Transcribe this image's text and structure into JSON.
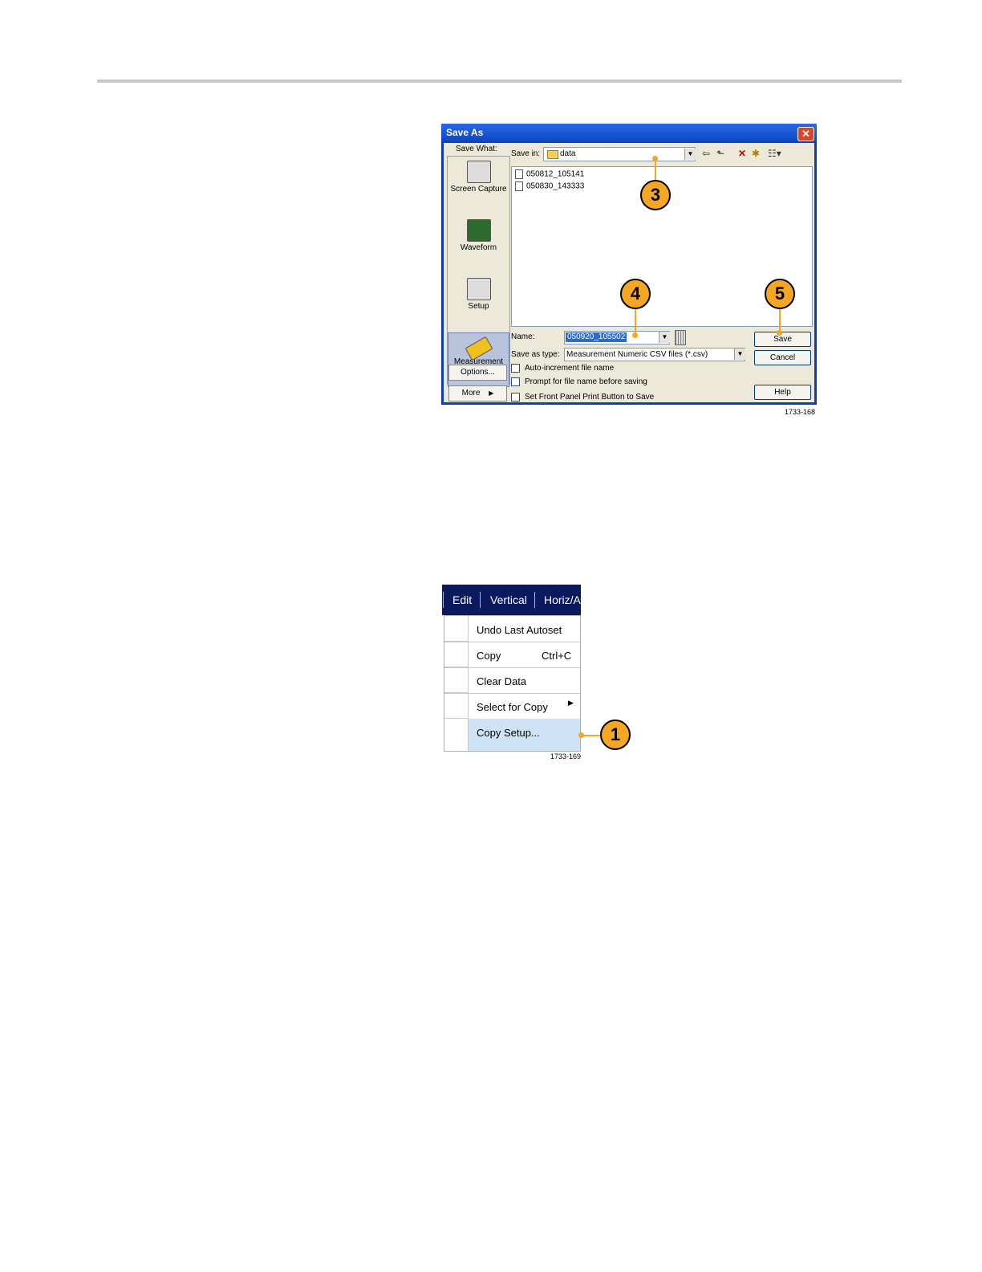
{
  "figure1": {
    "dialog_title": "Save As",
    "close_glyph": "✕",
    "save_what_label": "Save What:",
    "side_items": [
      {
        "label": "Screen Capture",
        "icon": "camera-icon"
      },
      {
        "label": "Waveform",
        "icon": "waveform-icon"
      },
      {
        "label": "Setup",
        "icon": "setup-icon"
      },
      {
        "label": "Measurement",
        "icon": "measurement-icon"
      }
    ],
    "options_label": "Options...",
    "more_label": "More",
    "more_arrow": "▶",
    "save_in_label": "Save in:",
    "save_in_value": "data",
    "dropdown_glyph": "▼",
    "toolbar_icons": {
      "back": "⇦",
      "up": "⬑",
      "delete": "✕",
      "new_folder": "✱",
      "views": "☷▾"
    },
    "files": [
      "050812_105141",
      "050830_143333"
    ],
    "name_label": "Name:",
    "name_value": "050920_105502",
    "type_label": "Save as type:",
    "type_value": "Measurement Numeric CSV files (*.csv)",
    "checkboxes": [
      "Auto-increment file name",
      "Prompt for file name before saving",
      "Set Front Panel Print Button to Save"
    ],
    "save_button": "Save",
    "cancel_button": "Cancel",
    "help_button": "Help",
    "figure_number": "1733-168",
    "callouts": [
      "3",
      "4",
      "5"
    ]
  },
  "figure2": {
    "menubar": [
      "Edit",
      "Vertical",
      "Horiz/Ac"
    ],
    "menu_items": [
      {
        "label": "Undo Last Autoset",
        "shortcut": "",
        "submenu": false
      },
      {
        "label": "Copy",
        "shortcut": "Ctrl+C",
        "submenu": false
      },
      {
        "label": "Clear Data",
        "shortcut": "",
        "submenu": false
      },
      {
        "label": "Select for Copy",
        "shortcut": "",
        "submenu": true
      },
      {
        "label": "Copy Setup...",
        "shortcut": "",
        "submenu": false
      }
    ],
    "submenu_arrow": "▶",
    "callout": "1",
    "figure_number": "1733-169"
  },
  "colors": {
    "callout": "#f5a623",
    "menubar": "#0b1a5e",
    "dialog_frame": "#0b3fb5",
    "highlight": "#cfe3f7"
  }
}
